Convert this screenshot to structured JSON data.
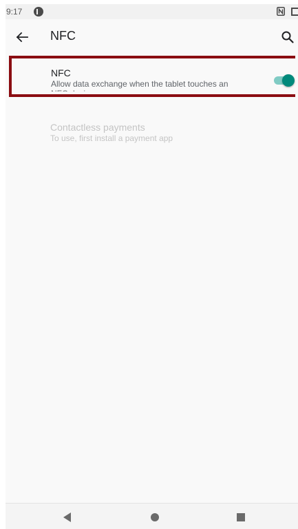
{
  "status_bar": {
    "time": "9:17",
    "icons": [
      "notification-icon",
      "nfc-icon",
      "battery-icon"
    ]
  },
  "app_bar": {
    "title": "NFC",
    "back_icon": "arrow-back-icon",
    "search_icon": "search-icon"
  },
  "settings": {
    "nfc": {
      "title": "NFC",
      "summary": "Allow data exchange when the tablet touches an NFC device",
      "enabled": true
    },
    "contactless": {
      "title": "Contactless payments",
      "summary": "To use, first install a payment app",
      "enabled": false
    }
  },
  "nav_bar": {
    "icons": [
      "nav-back-icon",
      "nav-home-icon",
      "nav-recents-icon"
    ]
  },
  "colors": {
    "accent": "#00897b",
    "accent_track": "#80cbc4",
    "highlight_border": "#8b0d12",
    "background": "#f9f9f9"
  }
}
